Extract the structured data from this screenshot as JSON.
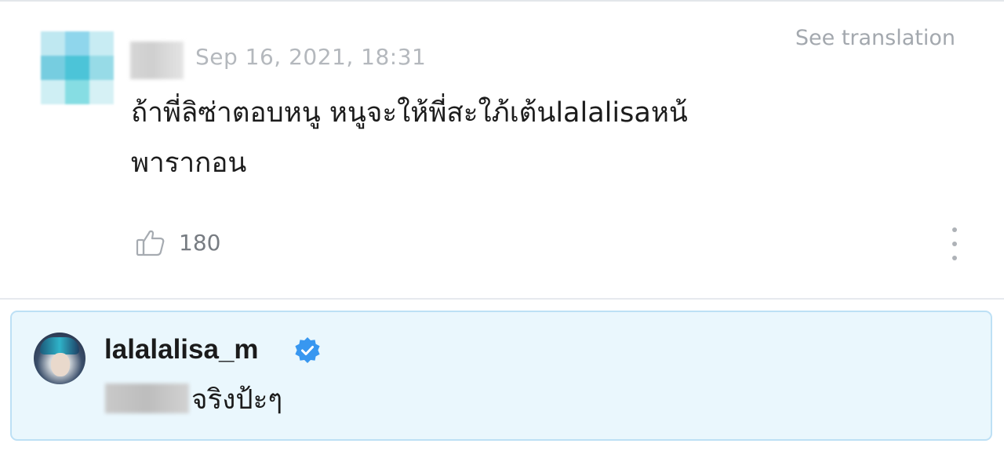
{
  "comment": {
    "timestamp": "Sep 16, 2021, 18:31",
    "see_translation_label": "See translation",
    "text_line1": "ถ้าพี่ลิซ่าตอบหนู หนูจะให้พี่สะใภ้เต้นlalalisaหน้",
    "text_line2": "พารากอน",
    "like_count": "180",
    "icons": {
      "like": "thumbs-up-icon",
      "more": "more-vertical-icon"
    }
  },
  "reply": {
    "username": "lalalalisa_m",
    "verified": true,
    "text": "จริงป้ะๆ",
    "icons": {
      "verified": "verified-badge-icon"
    }
  },
  "colors": {
    "reply_background": "#eaf7fd",
    "reply_border": "#bde0f5",
    "verified_blue": "#3897f0"
  }
}
